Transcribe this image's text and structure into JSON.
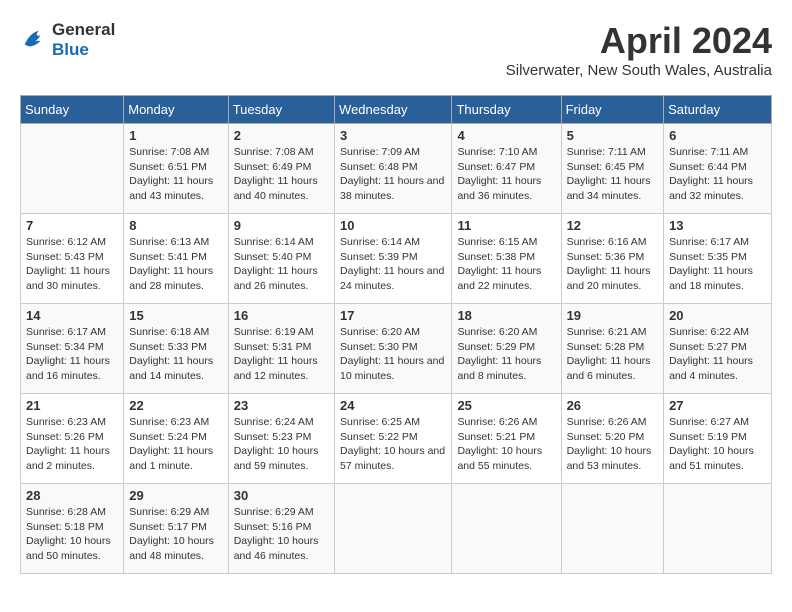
{
  "logo": {
    "general": "General",
    "blue": "Blue"
  },
  "title": "April 2024",
  "location": "Silverwater, New South Wales, Australia",
  "days_header": [
    "Sunday",
    "Monday",
    "Tuesday",
    "Wednesday",
    "Thursday",
    "Friday",
    "Saturday"
  ],
  "weeks": [
    [
      {
        "num": "",
        "sunrise": "",
        "sunset": "",
        "daylight": ""
      },
      {
        "num": "1",
        "sunrise": "Sunrise: 7:08 AM",
        "sunset": "Sunset: 6:51 PM",
        "daylight": "Daylight: 11 hours and 43 minutes."
      },
      {
        "num": "2",
        "sunrise": "Sunrise: 7:08 AM",
        "sunset": "Sunset: 6:49 PM",
        "daylight": "Daylight: 11 hours and 40 minutes."
      },
      {
        "num": "3",
        "sunrise": "Sunrise: 7:09 AM",
        "sunset": "Sunset: 6:48 PM",
        "daylight": "Daylight: 11 hours and 38 minutes."
      },
      {
        "num": "4",
        "sunrise": "Sunrise: 7:10 AM",
        "sunset": "Sunset: 6:47 PM",
        "daylight": "Daylight: 11 hours and 36 minutes."
      },
      {
        "num": "5",
        "sunrise": "Sunrise: 7:11 AM",
        "sunset": "Sunset: 6:45 PM",
        "daylight": "Daylight: 11 hours and 34 minutes."
      },
      {
        "num": "6",
        "sunrise": "Sunrise: 7:11 AM",
        "sunset": "Sunset: 6:44 PM",
        "daylight": "Daylight: 11 hours and 32 minutes."
      }
    ],
    [
      {
        "num": "7",
        "sunrise": "Sunrise: 6:12 AM",
        "sunset": "Sunset: 5:43 PM",
        "daylight": "Daylight: 11 hours and 30 minutes."
      },
      {
        "num": "8",
        "sunrise": "Sunrise: 6:13 AM",
        "sunset": "Sunset: 5:41 PM",
        "daylight": "Daylight: 11 hours and 28 minutes."
      },
      {
        "num": "9",
        "sunrise": "Sunrise: 6:14 AM",
        "sunset": "Sunset: 5:40 PM",
        "daylight": "Daylight: 11 hours and 26 minutes."
      },
      {
        "num": "10",
        "sunrise": "Sunrise: 6:14 AM",
        "sunset": "Sunset: 5:39 PM",
        "daylight": "Daylight: 11 hours and 24 minutes."
      },
      {
        "num": "11",
        "sunrise": "Sunrise: 6:15 AM",
        "sunset": "Sunset: 5:38 PM",
        "daylight": "Daylight: 11 hours and 22 minutes."
      },
      {
        "num": "12",
        "sunrise": "Sunrise: 6:16 AM",
        "sunset": "Sunset: 5:36 PM",
        "daylight": "Daylight: 11 hours and 20 minutes."
      },
      {
        "num": "13",
        "sunrise": "Sunrise: 6:17 AM",
        "sunset": "Sunset: 5:35 PM",
        "daylight": "Daylight: 11 hours and 18 minutes."
      }
    ],
    [
      {
        "num": "14",
        "sunrise": "Sunrise: 6:17 AM",
        "sunset": "Sunset: 5:34 PM",
        "daylight": "Daylight: 11 hours and 16 minutes."
      },
      {
        "num": "15",
        "sunrise": "Sunrise: 6:18 AM",
        "sunset": "Sunset: 5:33 PM",
        "daylight": "Daylight: 11 hours and 14 minutes."
      },
      {
        "num": "16",
        "sunrise": "Sunrise: 6:19 AM",
        "sunset": "Sunset: 5:31 PM",
        "daylight": "Daylight: 11 hours and 12 minutes."
      },
      {
        "num": "17",
        "sunrise": "Sunrise: 6:20 AM",
        "sunset": "Sunset: 5:30 PM",
        "daylight": "Daylight: 11 hours and 10 minutes."
      },
      {
        "num": "18",
        "sunrise": "Sunrise: 6:20 AM",
        "sunset": "Sunset: 5:29 PM",
        "daylight": "Daylight: 11 hours and 8 minutes."
      },
      {
        "num": "19",
        "sunrise": "Sunrise: 6:21 AM",
        "sunset": "Sunset: 5:28 PM",
        "daylight": "Daylight: 11 hours and 6 minutes."
      },
      {
        "num": "20",
        "sunrise": "Sunrise: 6:22 AM",
        "sunset": "Sunset: 5:27 PM",
        "daylight": "Daylight: 11 hours and 4 minutes."
      }
    ],
    [
      {
        "num": "21",
        "sunrise": "Sunrise: 6:23 AM",
        "sunset": "Sunset: 5:26 PM",
        "daylight": "Daylight: 11 hours and 2 minutes."
      },
      {
        "num": "22",
        "sunrise": "Sunrise: 6:23 AM",
        "sunset": "Sunset: 5:24 PM",
        "daylight": "Daylight: 11 hours and 1 minute."
      },
      {
        "num": "23",
        "sunrise": "Sunrise: 6:24 AM",
        "sunset": "Sunset: 5:23 PM",
        "daylight": "Daylight: 10 hours and 59 minutes."
      },
      {
        "num": "24",
        "sunrise": "Sunrise: 6:25 AM",
        "sunset": "Sunset: 5:22 PM",
        "daylight": "Daylight: 10 hours and 57 minutes."
      },
      {
        "num": "25",
        "sunrise": "Sunrise: 6:26 AM",
        "sunset": "Sunset: 5:21 PM",
        "daylight": "Daylight: 10 hours and 55 minutes."
      },
      {
        "num": "26",
        "sunrise": "Sunrise: 6:26 AM",
        "sunset": "Sunset: 5:20 PM",
        "daylight": "Daylight: 10 hours and 53 minutes."
      },
      {
        "num": "27",
        "sunrise": "Sunrise: 6:27 AM",
        "sunset": "Sunset: 5:19 PM",
        "daylight": "Daylight: 10 hours and 51 minutes."
      }
    ],
    [
      {
        "num": "28",
        "sunrise": "Sunrise: 6:28 AM",
        "sunset": "Sunset: 5:18 PM",
        "daylight": "Daylight: 10 hours and 50 minutes."
      },
      {
        "num": "29",
        "sunrise": "Sunrise: 6:29 AM",
        "sunset": "Sunset: 5:17 PM",
        "daylight": "Daylight: 10 hours and 48 minutes."
      },
      {
        "num": "30",
        "sunrise": "Sunrise: 6:29 AM",
        "sunset": "Sunset: 5:16 PM",
        "daylight": "Daylight: 10 hours and 46 minutes."
      },
      {
        "num": "",
        "sunrise": "",
        "sunset": "",
        "daylight": ""
      },
      {
        "num": "",
        "sunrise": "",
        "sunset": "",
        "daylight": ""
      },
      {
        "num": "",
        "sunrise": "",
        "sunset": "",
        "daylight": ""
      },
      {
        "num": "",
        "sunrise": "",
        "sunset": "",
        "daylight": ""
      }
    ]
  ]
}
